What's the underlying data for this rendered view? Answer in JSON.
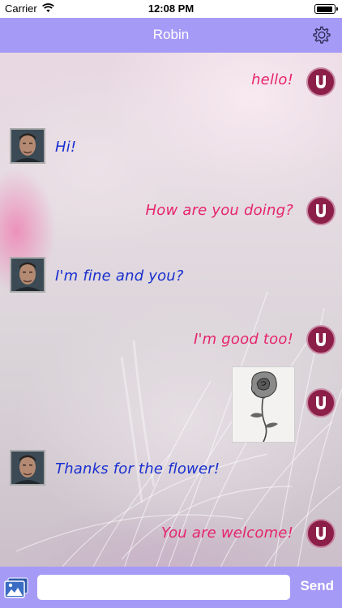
{
  "status_bar": {
    "carrier": "Carrier",
    "time": "12:08 PM",
    "battery_level": 0.95
  },
  "nav": {
    "title": "Robin",
    "settings_icon": "gear-icon"
  },
  "messages": [
    {
      "from": "me",
      "type": "text",
      "text": "hello!"
    },
    {
      "from": "robin",
      "type": "text",
      "text": "Hi!"
    },
    {
      "from": "me",
      "type": "text",
      "text": "How are you doing?"
    },
    {
      "from": "robin",
      "type": "text",
      "text": "I'm fine and you?"
    },
    {
      "from": "me",
      "type": "text",
      "text": "I'm good too!"
    },
    {
      "from": "me",
      "type": "image",
      "image": "rose drawing"
    },
    {
      "from": "robin",
      "type": "text",
      "text": "Thanks for the flower!"
    },
    {
      "from": "me",
      "type": "text",
      "text": "You are welcome!"
    }
  ],
  "input_bar": {
    "photo_icon": "photo-library-icon",
    "input_value": "",
    "send_label": "Send"
  },
  "colors": {
    "nav_bar": "#a69af7",
    "outgoing_text": "#e6246a",
    "incoming_text": "#1a2fd0",
    "user_avatar": "#8c1f48"
  }
}
